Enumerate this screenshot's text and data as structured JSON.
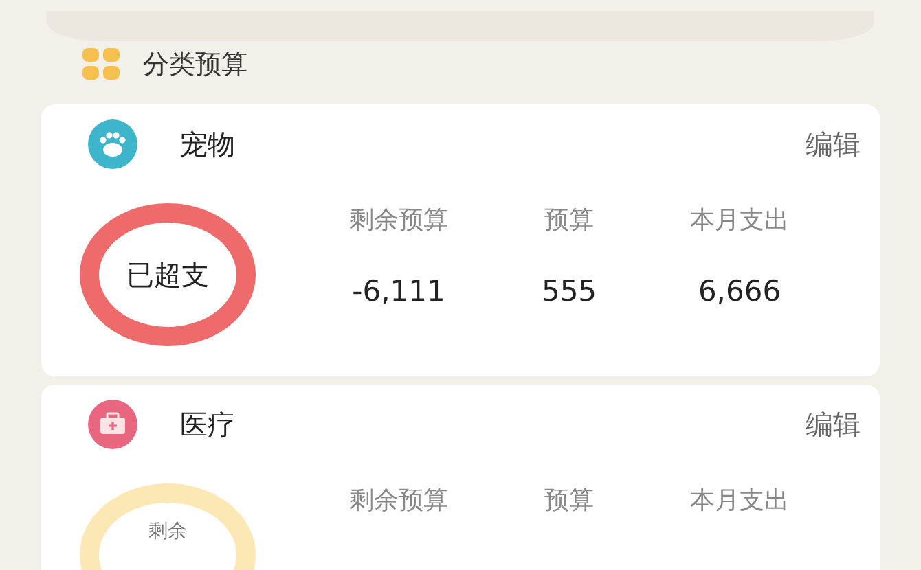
{
  "section": {
    "title": "分类预算"
  },
  "categories": [
    {
      "name": "宠物",
      "kind": "paw",
      "edit": "编辑",
      "ring": {
        "kind": "over",
        "label": "已超支"
      },
      "stats": [
        {
          "label": "剩余预算",
          "value": "-6,111"
        },
        {
          "label": "预算",
          "value": "555"
        },
        {
          "label": "本月支出",
          "value": "6,666"
        }
      ]
    },
    {
      "name": "医疗",
      "kind": "medkit",
      "edit": "编辑",
      "ring": {
        "kind": "remaining",
        "label": "剩余"
      },
      "stats": [
        {
          "label": "剩余预算"
        },
        {
          "label": "预算"
        },
        {
          "label": "本月支出"
        }
      ]
    }
  ]
}
